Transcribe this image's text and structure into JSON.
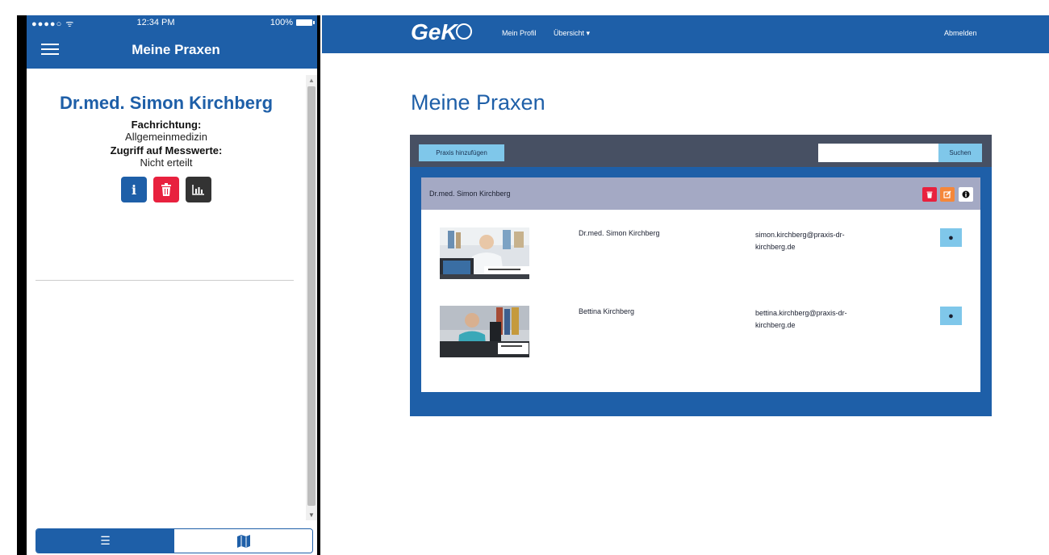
{
  "phone": {
    "status": {
      "carrier": "●●●●○ ᯤ",
      "time": "12:34 PM",
      "battery": "100%"
    },
    "app_title": "Meine Praxen",
    "doctor": {
      "name": "Dr.med. Simon Kirchberg",
      "specialty_label": "Fachrichtung:",
      "specialty_value": "Allgemeinmedizin",
      "access_label": "Zugriff auf Messwerte:",
      "access_value": "Nicht erteilt"
    },
    "actions": {
      "info": "i",
      "delete": "🗑",
      "chart": "▥"
    },
    "bottom_tabs": {
      "list": "☰",
      "map": "▥"
    }
  },
  "web": {
    "brand": "GeK",
    "nav": {
      "profile": "Mein Profil",
      "overview": "Übersicht ▾",
      "logout": "Abmelden"
    },
    "page_title": "Meine Praxen",
    "toolbar": {
      "add_label": "Praxis hinzufügen",
      "search_placeholder": "",
      "search_label": "Suchen"
    },
    "praxis": {
      "title": "Dr.med. Simon Kirchberg",
      "members": [
        {
          "name": "Dr.med. Simon Kirchberg",
          "email": "simon.kirchberg@praxis-dr-kirchberg.de",
          "info": "●"
        },
        {
          "name": "Bettina Kirchberg",
          "email": "bettina.kirchberg@praxis-dr-kirchberg.de",
          "info": "●"
        }
      ]
    }
  },
  "colors": {
    "primary": "#1e5fa8",
    "accent": "#7fc7ea",
    "danger": "#e8213e",
    "warning": "#f5873a",
    "bar": "#475063",
    "card_head": "#a4a9c4"
  }
}
